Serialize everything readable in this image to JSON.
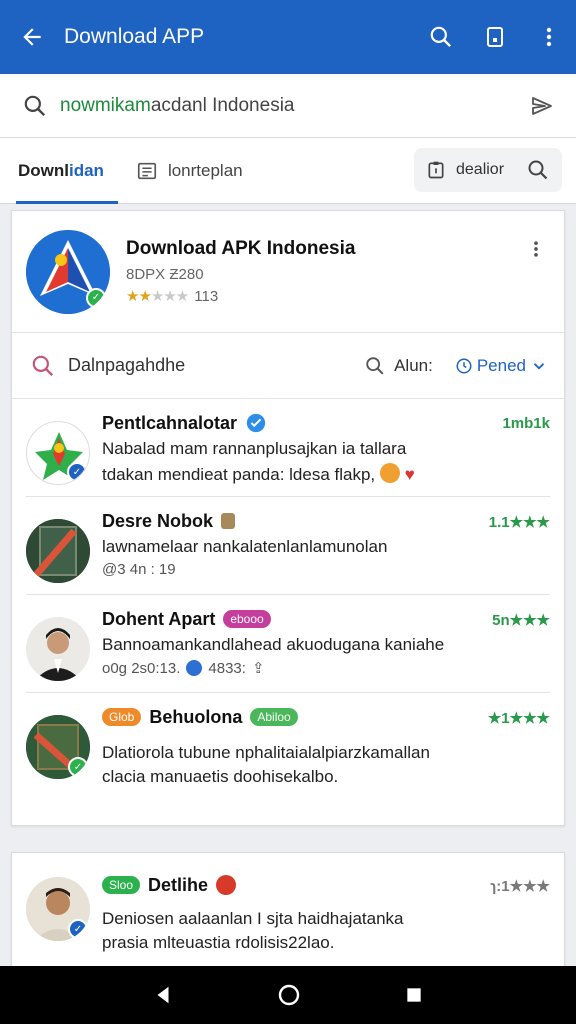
{
  "appbar": {
    "title": "Download APP",
    "back_icon": "arrow-left-icon",
    "actions": [
      "search-icon",
      "bookmark-icon",
      "more-vert-icon"
    ]
  },
  "search": {
    "prefix": "nowmikam",
    "rest": "acdanl Indonesia"
  },
  "tabs": {
    "first_a": "Downl",
    "first_b": "idan",
    "second": "lonrteplan",
    "button": "dealior"
  },
  "app": {
    "name": "Download APK Indonesia",
    "sub": "8DPX Ƶ280",
    "rating_text": "113",
    "stars_filled": 2,
    "stars_total": 5
  },
  "filter": {
    "text": "Dalnpagahdhe",
    "sort_label": "Alun:",
    "sort_value": "Pened"
  },
  "items": [
    {
      "name": "Pentlcahnalotar",
      "line1": "Nabalad mam rannanplusajkan ia tallara",
      "line2": "tdakan mendieat panda: ldesa flakp,",
      "rating": "1mb1k"
    },
    {
      "name": "Desre Nobok",
      "line1": "lawnamelaar nankalatenlanlamunolan",
      "meta": "@3 4n : 19",
      "rating": "1.1★★★"
    },
    {
      "name": "Dohent Apart",
      "chip": "ebooo",
      "line1": "Bannoamankandlahead akuodugana kaniahe",
      "meta": "o0g 2s0:13.",
      "meta2": "4833:",
      "rating": "5n★★★"
    },
    {
      "name": "Behuolona",
      "chip_pre": "Glob",
      "chip": "Abiloo",
      "line1": "Dlatiorola tubune nphalitaialalpiarzkamallan",
      "line2": "clacia manuaetis doohisekalbo.",
      "rating": "★1★★★"
    }
  ],
  "card2": {
    "chip": "Sloo",
    "name": "Detlihe",
    "line1": "Deniosen aalaanlan I sjta haidhajatanka",
    "line2": "prasia mlteuastia rdolisis22lao.",
    "rating": "ɿ:1★★★"
  },
  "colors": {
    "primary": "#1f63c2",
    "rating_green": "#2a9a4a",
    "badge_green": "#2bb24c"
  }
}
